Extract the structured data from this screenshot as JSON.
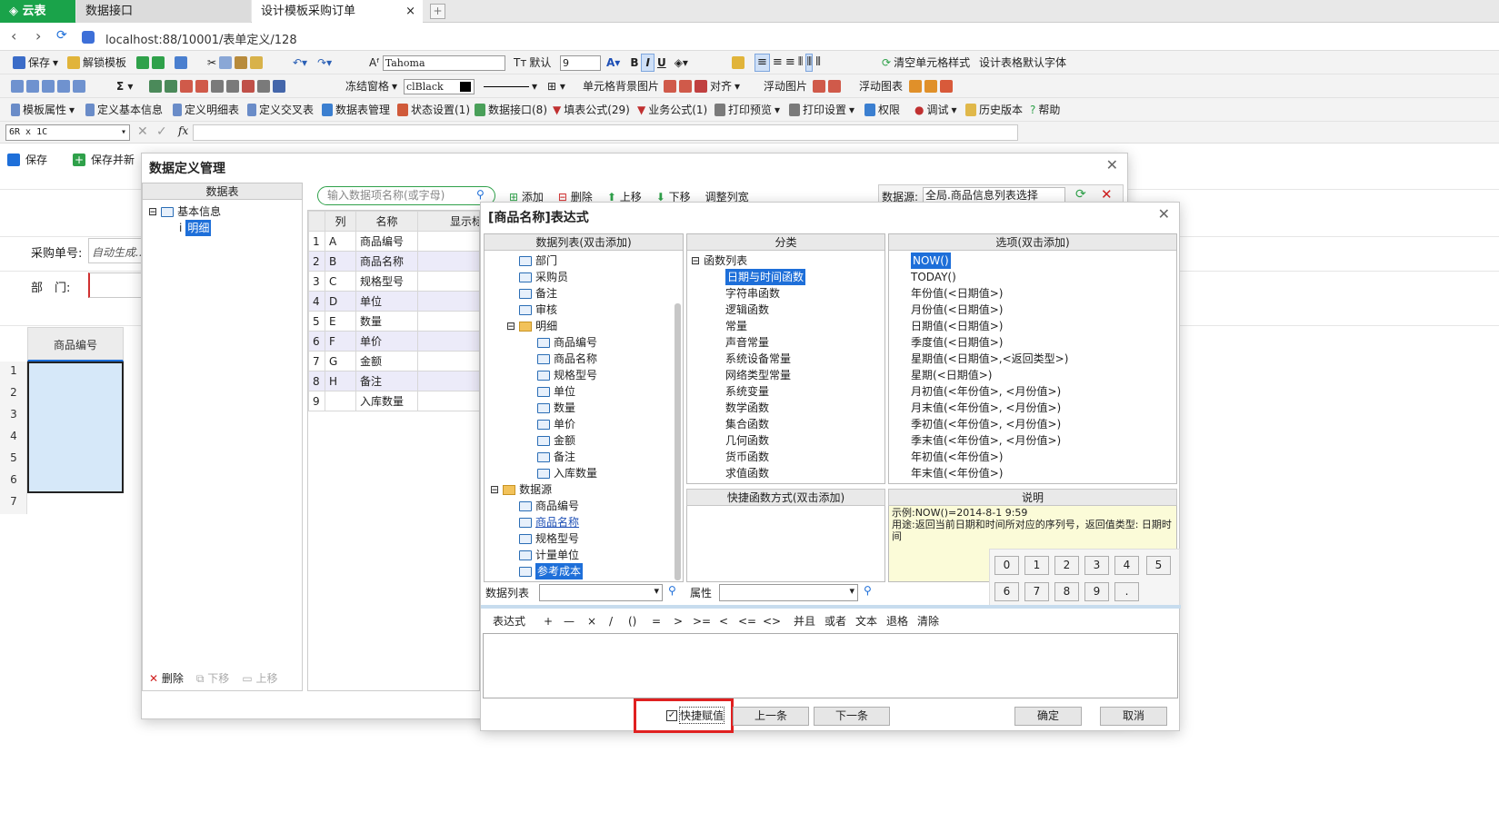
{
  "tabs": {
    "app": "云表",
    "t1": "数据接口",
    "t2": "设计模板采购订单"
  },
  "address": "localhost:88/10001/表单定义/128",
  "toolbar1": {
    "save": "保存",
    "unlock": "解锁模板",
    "font": "Tahoma",
    "default_size": "默认",
    "size": "9",
    "clear_style": "清空单元格样式",
    "default_font": "设计表格默认字体"
  },
  "toolbar2": {
    "freeze": "冻结窗格",
    "color": "clBlack",
    "bg_image": "单元格背景图片",
    "align": "对齐",
    "float_image": "浮动图片",
    "float_chart": "浮动图表"
  },
  "toolbar3": {
    "items": [
      "模板属性",
      "定义基本信息",
      "定义明细表",
      "定义交叉表",
      "数据表管理",
      "状态设置(1)",
      "数据接口(8)",
      "填表公式(29)",
      "业务公式(1)",
      "打印预览",
      "打印设置",
      "权限",
      "调试",
      "历史版本",
      "帮助"
    ]
  },
  "formula_bar": {
    "name_box": "6R x 1C",
    "fx": "fx"
  },
  "form": {
    "save": "保存",
    "save_new": "保存并新",
    "purchase_no_label": "采购单号:",
    "purchase_no_value": "自动生成...",
    "dept_label": "部　门:",
    "col_header": "商品编号",
    "row_numbers": [
      "1",
      "2",
      "3",
      "4",
      "5",
      "6",
      "7"
    ]
  },
  "dm": {
    "title": "数据定义管理",
    "table_header": "数据表",
    "tree_root": "基本信息",
    "tree_child": "明细",
    "search_placeholder": "输入数据项名称(或字母)",
    "add": "添加",
    "delete": "删除",
    "move_up": "上移",
    "move_down": "下移",
    "adjust": "调整列宽",
    "source_label": "数据源:",
    "source_value": "全局.商品信息列表选择",
    "col_headers": [
      "列",
      "名称",
      "显示标题"
    ],
    "rows": [
      [
        "1",
        "A",
        "商品编号"
      ],
      [
        "2",
        "B",
        "商品名称"
      ],
      [
        "3",
        "C",
        "规格型号"
      ],
      [
        "4",
        "D",
        "单位"
      ],
      [
        "5",
        "E",
        "数量"
      ],
      [
        "6",
        "F",
        "单价"
      ],
      [
        "7",
        "G",
        "金额"
      ],
      [
        "8",
        "H",
        "备注"
      ],
      [
        "9",
        "",
        "入库数量"
      ]
    ],
    "bottom_delete": "删除",
    "bottom_down": "下移",
    "bottom_up": "上移"
  },
  "ex": {
    "title": "[商品名称]表达式",
    "data_list_header": "数据列表(双击添加)",
    "category_header": "分类",
    "options_header": "选项(双击添加)",
    "shortcut_header": "快捷函数方式(双击添加)",
    "desc_header": "说明",
    "data_list": [
      "部门",
      "采购员",
      "备注",
      "审核",
      "明细",
      "商品编号",
      "商品名称",
      "规格型号",
      "单位",
      "数量",
      "单价",
      "金额",
      "备注",
      "入库数量",
      "数据源",
      "商品编号",
      "商品名称",
      "规格型号",
      "计量单位",
      "参考成本"
    ],
    "categories": [
      "函数列表",
      "日期与时间函数",
      "字符串函数",
      "逻辑函数",
      "常量",
      "声音常量",
      "系统设备常量",
      "网络类型常量",
      "系统变量",
      "数学函数",
      "集合函数",
      "几何函数",
      "货币函数",
      "求值函数"
    ],
    "options": [
      "NOW()",
      "TODAY()",
      "年份值(<日期值>)",
      "月份值(<日期值>)",
      "日期值(<日期值>)",
      "季度值(<日期值>)",
      "星期值(<日期值>,<返回类型>)",
      "星期(<日期值>)",
      "月初值(<年份值>, <月份值>)",
      "月末值(<年份值>, <月份值>)",
      "季初值(<年份值>, <月份值>)",
      "季末值(<年份值>, <月份值>)",
      "年初值(<年份值>)",
      "年末值(<年份值>)"
    ],
    "desc_example": "示例:NOW()=2014-8-1 9:59",
    "desc_usage": "用途:返回当前日期和时间所对应的序列号，返回值类型: 日期时间",
    "keypad": [
      "0",
      "1",
      "2",
      "3",
      "4",
      "5",
      "6",
      "7",
      "8",
      "9",
      "."
    ],
    "data_list_label": "数据列表",
    "attr_label": "属性",
    "operators": [
      "表达式",
      "+",
      "—",
      "×",
      "/",
      "()",
      "=",
      ">",
      ">=",
      "<",
      "<=",
      "<>",
      "并且",
      "或者",
      "文本",
      "退格",
      "清除"
    ],
    "quick_assign": "快捷赋值",
    "prev": "上一条",
    "next": "下一条",
    "ok": "确定",
    "cancel": "取消"
  },
  "colors": {
    "selection": "#1e6fd9",
    "highlight_box": "#e02020",
    "app_tab": "#1aa34a"
  }
}
